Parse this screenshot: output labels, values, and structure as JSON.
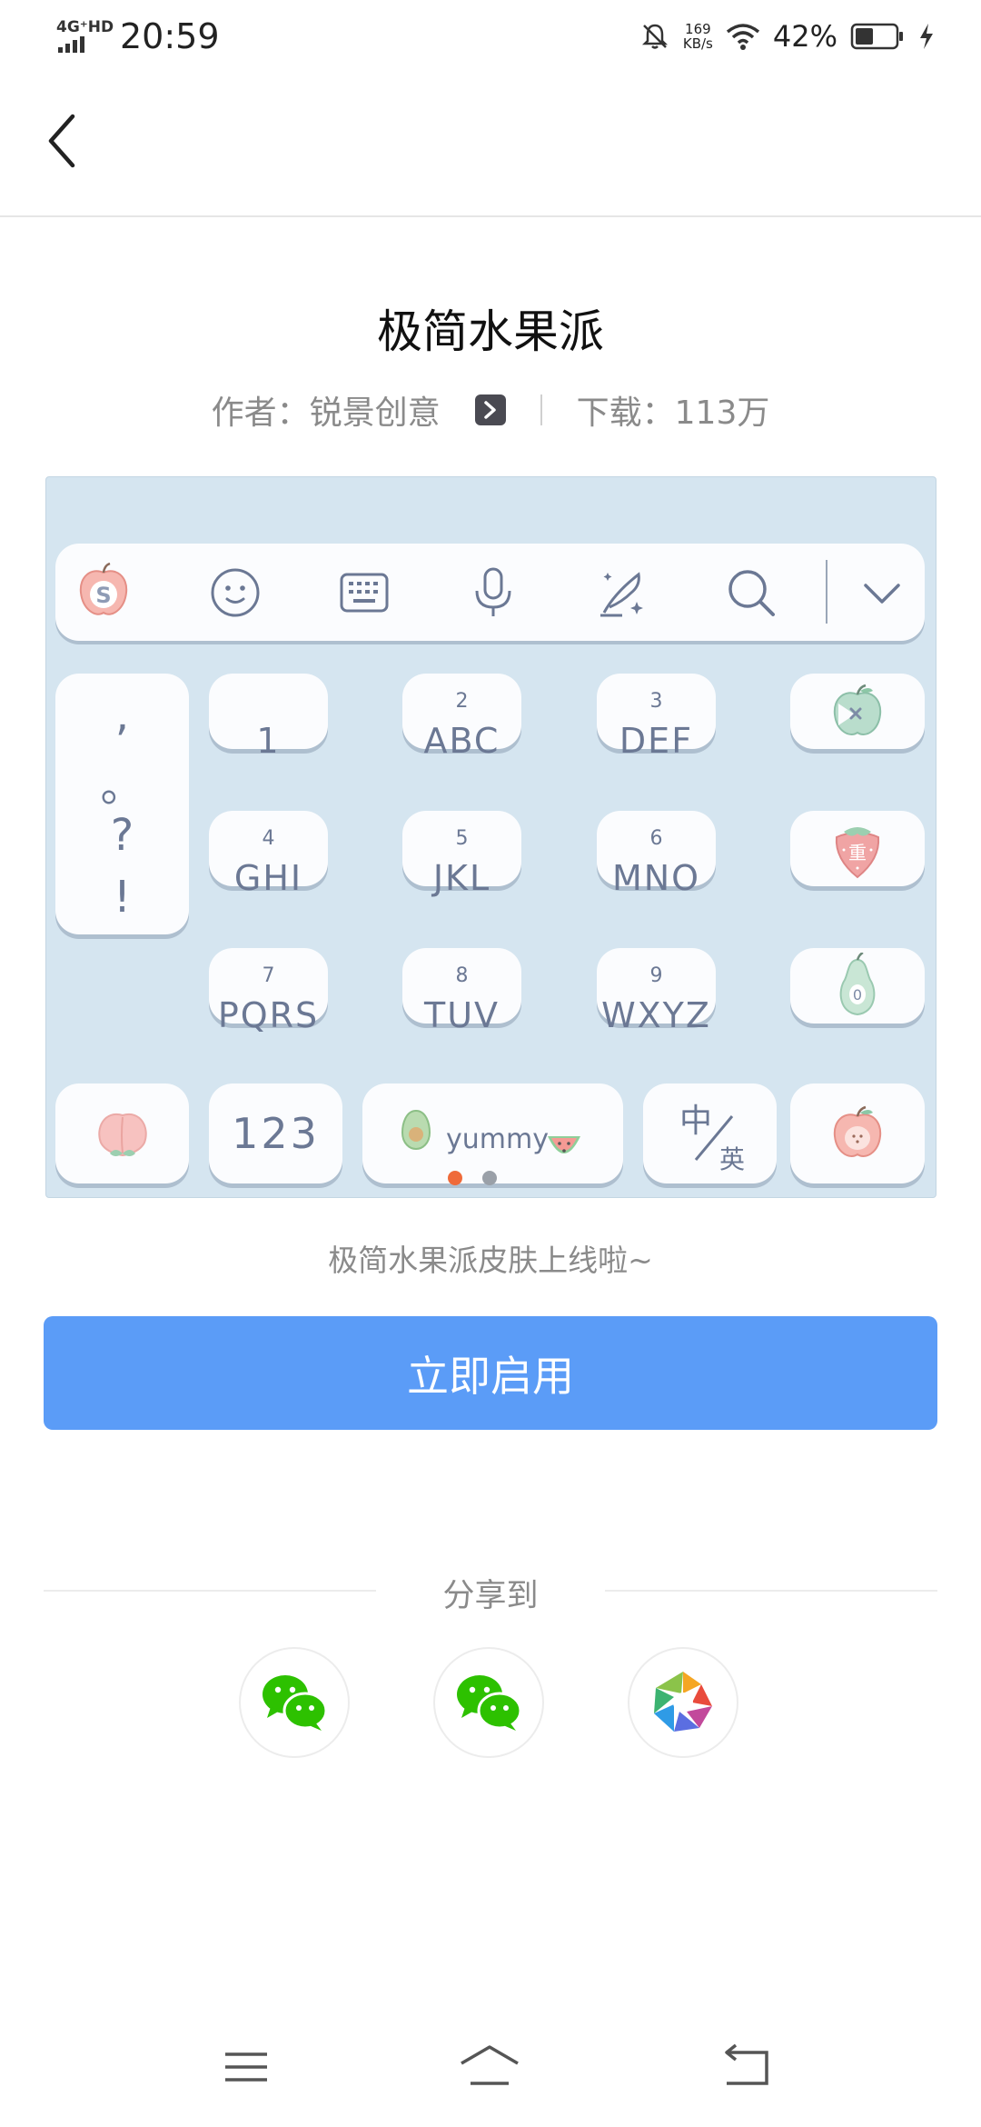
{
  "status_bar": {
    "network": "4G⁺HD",
    "time": "20:59",
    "speed_value": "169",
    "speed_unit": "KB/s",
    "battery": "42%"
  },
  "header": {
    "back_icon": "chevron-left-icon"
  },
  "skin": {
    "title": "极简水果派",
    "author": "作者：锐景创意",
    "downloads": "下载：113万",
    "caption": "极简水果派皮肤上线啦~"
  },
  "keyboard": {
    "left_punct": [
      ",",
      "。",
      "?",
      "!"
    ],
    "keys": [
      {
        "num": "",
        "letters": "1"
      },
      {
        "num": "2",
        "letters": "ABC"
      },
      {
        "num": "3",
        "letters": "DEF"
      },
      {
        "num": "4",
        "letters": "GHI"
      },
      {
        "num": "5",
        "letters": "JKL"
      },
      {
        "num": "6",
        "letters": "MNO"
      },
      {
        "num": "7",
        "letters": "PQRS"
      },
      {
        "num": "8",
        "letters": "TUV"
      },
      {
        "num": "9",
        "letters": "WXYZ"
      }
    ],
    "bottom": {
      "numbers": "123",
      "space": "yummy",
      "lang_top": "中",
      "lang_bottom": "英"
    }
  },
  "enable_button": "立即启用",
  "share": {
    "label": "分享到",
    "targets": [
      "wechat-icon",
      "wechat-moments-icon",
      "album-icon"
    ]
  },
  "colors": {
    "accent": "#5b9cf7",
    "keyboard_bg": "#d5e5f0",
    "key_text": "#6b7894",
    "wechat_green": "#2dc100"
  }
}
